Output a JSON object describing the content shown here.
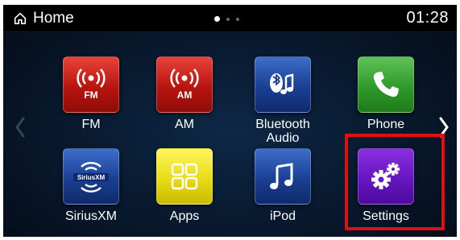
{
  "header": {
    "title": "Home",
    "time": "01:28",
    "page_indicator": {
      "pages": 3,
      "current": 1
    }
  },
  "tiles": [
    {
      "label": "FM",
      "icon": "radio-fm-icon",
      "badge": "FM",
      "color": "#b8150f"
    },
    {
      "label": "AM",
      "icon": "radio-am-icon",
      "badge": "AM",
      "color": "#b8150f"
    },
    {
      "label": "Bluetooth Audio",
      "icon": "bluetooth-audio-icon",
      "color": "#1a3f93"
    },
    {
      "label": "Phone",
      "icon": "phone-icon",
      "color": "#2f9a2a"
    },
    {
      "label": "SiriusXM",
      "icon": "siriusxm-icon",
      "badge": "SiriusXM",
      "color": "#1a3f93"
    },
    {
      "label": "Apps",
      "icon": "apps-grid-icon",
      "color": "#e8dc17"
    },
    {
      "label": "iPod",
      "icon": "music-note-icon",
      "color": "#1a3f93"
    },
    {
      "label": "Settings",
      "icon": "gears-icon",
      "color": "#6515c2"
    }
  ],
  "highlight_color": "#e01010"
}
